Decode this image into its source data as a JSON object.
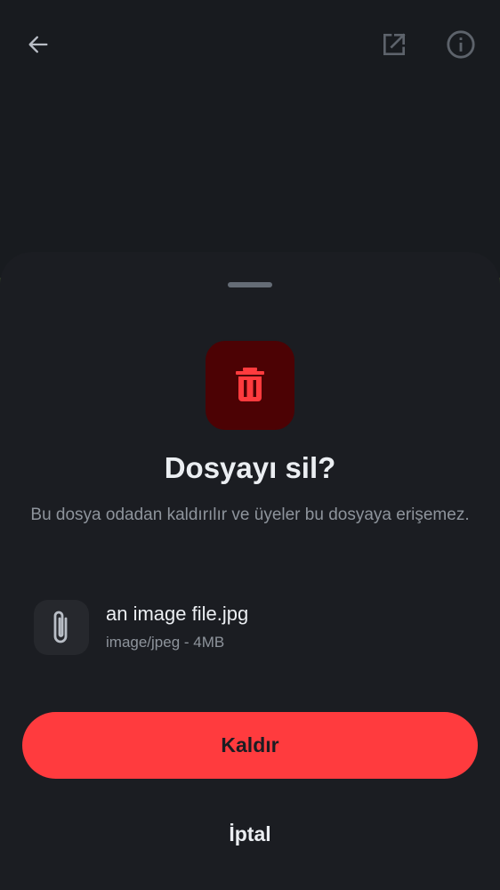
{
  "topbar": {
    "back_icon": "arrow-left-icon",
    "open_external_icon": "open-external-icon",
    "info_icon": "info-icon",
    "icon_color": "#b9bec6"
  },
  "dialog": {
    "icon": "trash-icon",
    "icon_color": "#ff3b3e",
    "icon_bg": "#4c0204",
    "title": "Dosyayı sil?",
    "description": "Bu dosya odadan kaldırılır ve üyeler bu dosyaya erişemez.",
    "file": {
      "icon": "paperclip-icon",
      "name": "an image file.jpg",
      "meta": "image/jpeg - 4MB"
    },
    "confirm_label": "Kaldır",
    "confirm_color": "#ff3b3e",
    "cancel_label": "İptal"
  }
}
